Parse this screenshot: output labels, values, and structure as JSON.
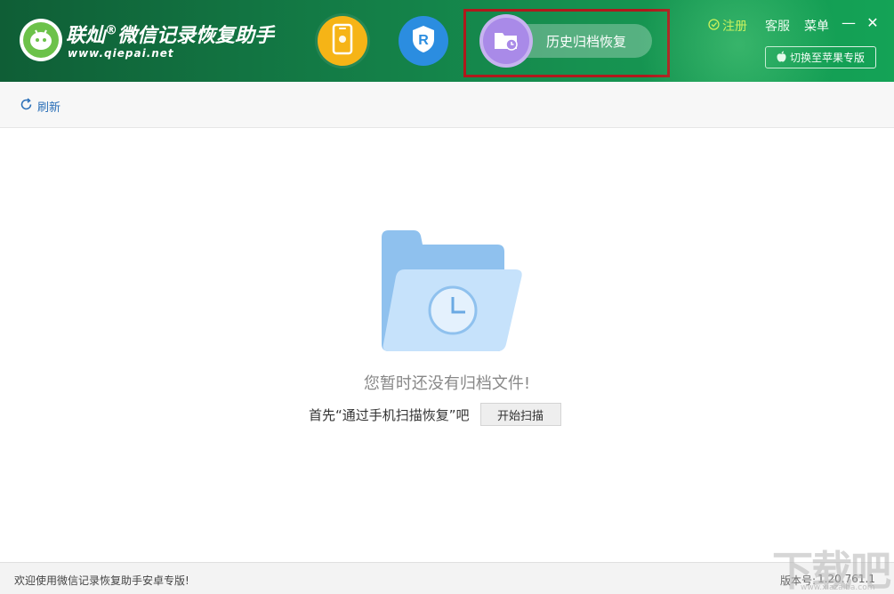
{
  "header": {
    "brand_name": "联灿",
    "brand_reg": "®",
    "brand_product": "微信记录恢复助手",
    "brand_url": "www.qiepai.net",
    "modes": [
      {
        "name": "android-mode",
        "icon": "phone-icon"
      },
      {
        "name": "ios-mode",
        "icon": "shield-r-icon",
        "glyph": "R"
      },
      {
        "name": "history-archive",
        "icon": "folder-clock-icon",
        "label": "历史归档恢复",
        "selected": true
      }
    ],
    "register_label": "注册",
    "service_label": "客服",
    "menu_label": "菜单",
    "minimize_glyph": "—",
    "close_glyph": "✕",
    "switch_label": "切换至苹果专版",
    "highlight_color": "#b0191c"
  },
  "toolbar": {
    "refresh_label": "刷新"
  },
  "main": {
    "empty_message": "您暂时还没有归档文件!",
    "hint_text": "首先“通过手机扫描恢复”吧",
    "scan_button_label": "开始扫描"
  },
  "statusbar": {
    "welcome_text": "欢迎使用微信记录恢复助手安卓专版!",
    "version_label": "版本号:",
    "version_value": "1.20.761.1"
  },
  "watermark": {
    "text": "下载吧",
    "url": "www.xiazaiba.com"
  },
  "colors": {
    "header_green": "#137a45",
    "android_orange": "#f6b416",
    "ios_blue": "#2b8de0",
    "history_purple": "#a98ae8",
    "link_blue": "#2a6fb8",
    "register_yellow": "#e6f54a"
  }
}
